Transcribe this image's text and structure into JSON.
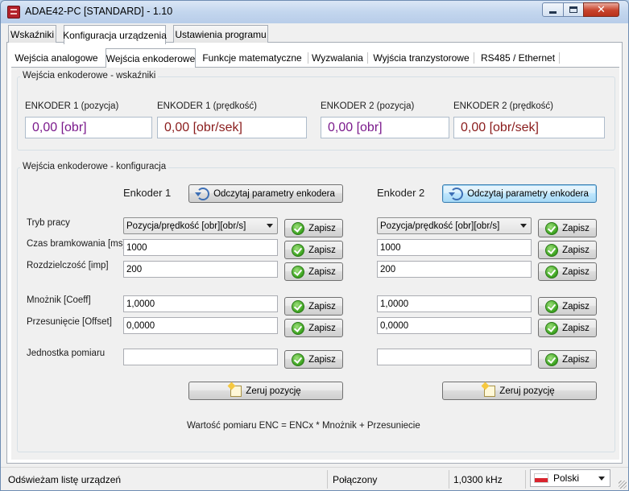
{
  "window": {
    "title": "ADAE42-PC [STANDARD] - 1.10",
    "controls": {
      "minimize": "minimize",
      "maximize": "maximize",
      "close": "✕"
    }
  },
  "main_tabs": [
    {
      "label": "Wskaźniki",
      "active": false
    },
    {
      "label": "Konfiguracja urządzenia",
      "active": true
    },
    {
      "label": "Ustawienia programu",
      "active": false
    }
  ],
  "sub_tabs": [
    {
      "label": "Wejścia analogowe",
      "active": false
    },
    {
      "label": "Wejścia enkoderowe",
      "active": true
    },
    {
      "label": "Funkcje matematyczne",
      "active": false
    },
    {
      "label": "Wyzwalania",
      "active": false
    },
    {
      "label": "Wyjścia tranzystorowe",
      "active": false
    },
    {
      "label": "RS485 / Ethernet",
      "active": false
    }
  ],
  "indicators": {
    "group_title": "Wejścia enkoderowe - wskaźniki",
    "items": [
      {
        "label": "ENKODER 1 (pozycja)",
        "value": "0,00 [obr]",
        "color": "#7b1a8c"
      },
      {
        "label": "ENKODER 1 (prędkość)",
        "value": "0,00 [obr/sek]",
        "color": "#8a1c1c"
      },
      {
        "label": "ENKODER 2 (pozycja)",
        "value": "0,00 [obr]",
        "color": "#7b1a8c"
      },
      {
        "label": "ENKODER 2 (prędkość)",
        "value": "0,00 [obr/sek]",
        "color": "#8a1c1c"
      }
    ]
  },
  "config": {
    "group_title": "Wejścia enkoderowe - konfiguracja",
    "labels": {
      "mode": "Tryb pracy",
      "gate_time": "Czas bramkowania [ms]",
      "resolution": "Rozdzielczość [imp]",
      "multiplier": "Mnożnik [Coeff]",
      "offset": "Przesunięcie [Offset]",
      "unit": "Jednostka pomiaru"
    },
    "save_label": "Zapisz",
    "read_label": "Odczytaj parametry enkodera",
    "reset_label": "Zeruj pozycję",
    "formula": "Wartość pomiaru ENC = ENCx * Mnożnik + Przesuniecie",
    "encoders": [
      {
        "heading": "Enkoder 1",
        "mode": "Pozycja/prędkość [obr][obr/s]",
        "gate_time": "1000",
        "resolution": "200",
        "multiplier": "1,0000",
        "offset": "0,0000",
        "unit": ""
      },
      {
        "heading": "Enkoder 2",
        "mode": "Pozycja/prędkość [obr][obr/s]",
        "gate_time": "1000",
        "resolution": "200",
        "multiplier": "1,0000",
        "offset": "0,0000",
        "unit": ""
      }
    ]
  },
  "status": {
    "message": "Odświeżam listę urządzeń",
    "connection": "Połączony",
    "frequency": "1,0300 kHz",
    "language": "Polski"
  }
}
